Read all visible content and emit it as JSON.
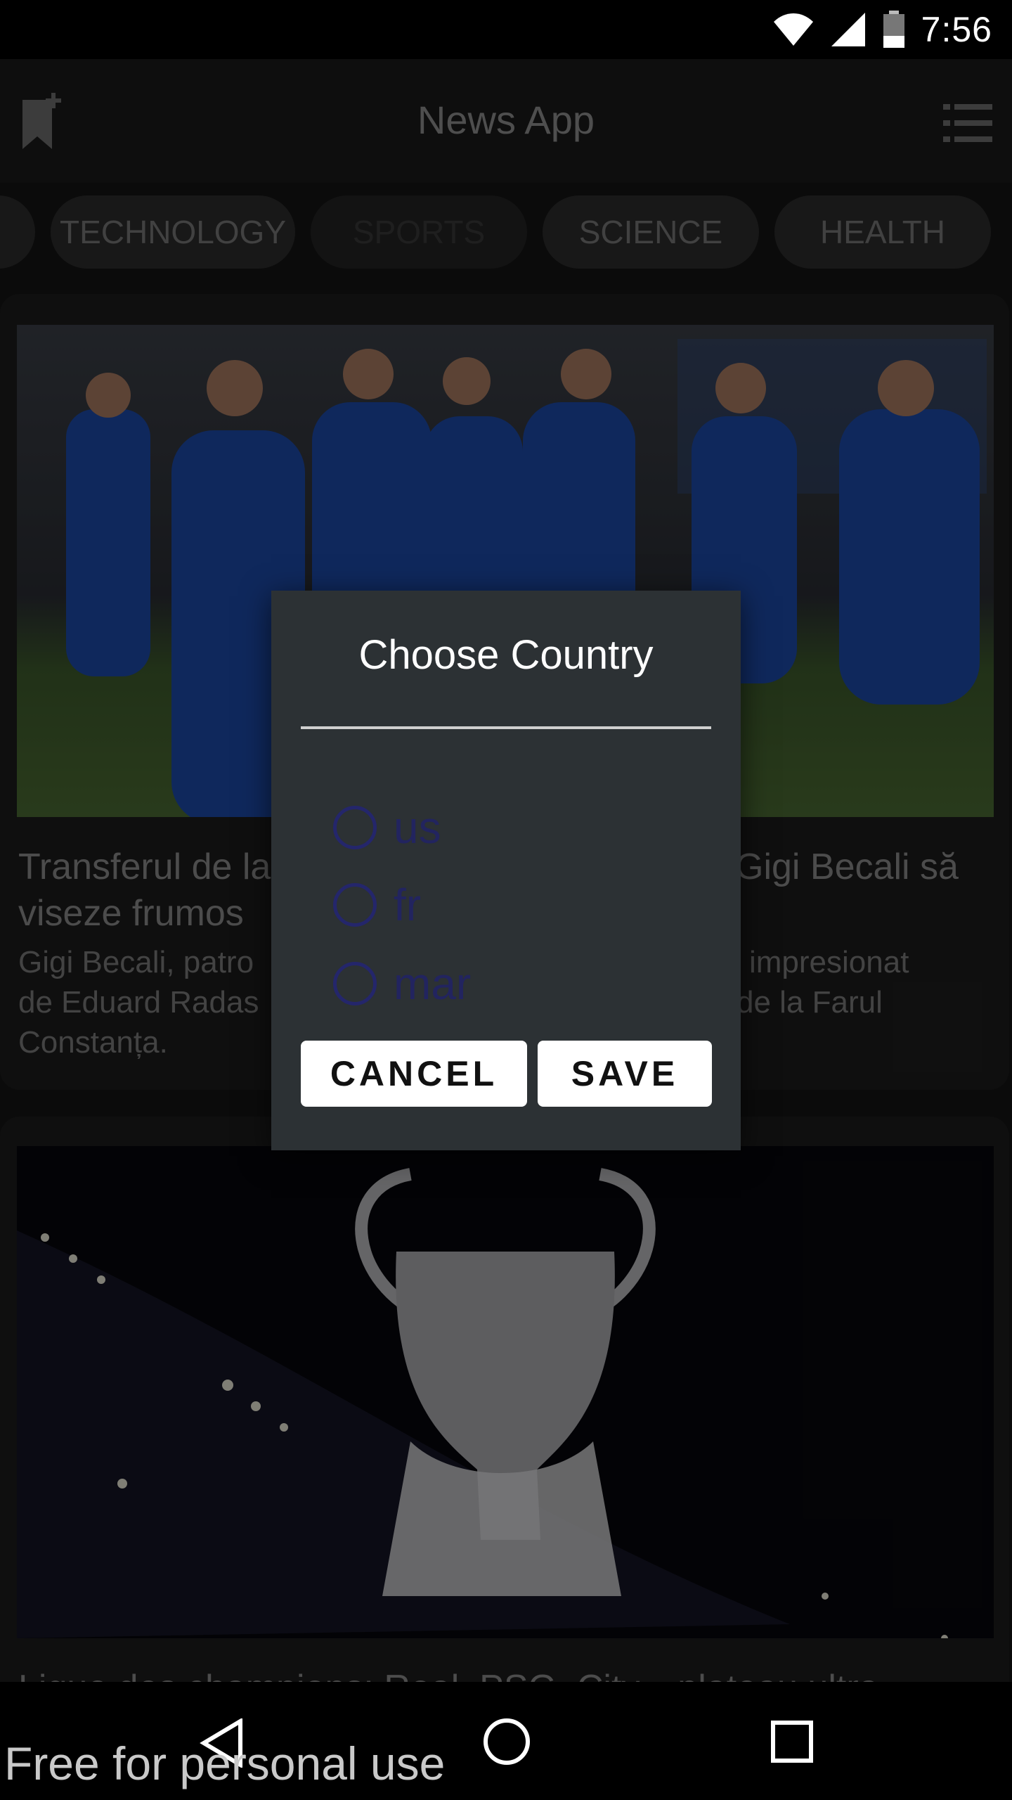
{
  "status": {
    "time": "7:56",
    "icons": [
      "wifi-icon",
      "signal-icon",
      "battery-icon"
    ]
  },
  "app": {
    "title": "News App",
    "icons": [
      "bookmark-add-icon",
      "menu-list-icon"
    ]
  },
  "categories": [
    "TECHNOLOGY",
    "SPORTS",
    "SCIENCE",
    "HEALTH"
  ],
  "articles": [
    {
      "title_line1_left": "Transferul de la",
      "title_line1_right": "Gigi Becali să",
      "title_line2": "viseze frumos",
      "desc_line1_left": "Gigi Becali, patro",
      "desc_line1_right": "impresionat",
      "desc_line2_left": "de Eduard Radas",
      "desc_line2_right": "de la Farul",
      "desc_line3": "Constanța."
    },
    {
      "title": "Ligue des champions: Real, PSG, City... plateau ultra"
    }
  ],
  "dialog": {
    "title": "Choose Country",
    "options": [
      "us",
      "fr",
      "mar"
    ],
    "cancel_label": "CANCEL",
    "save_label": "SAVE"
  },
  "nav": {
    "icons": [
      "back-icon",
      "home-icon",
      "recents-icon"
    ]
  },
  "watermark": "Free for personal use",
  "colors": {
    "accent": "#24266b",
    "dialog_bg": "#2c3134",
    "scrim": "#000000"
  }
}
